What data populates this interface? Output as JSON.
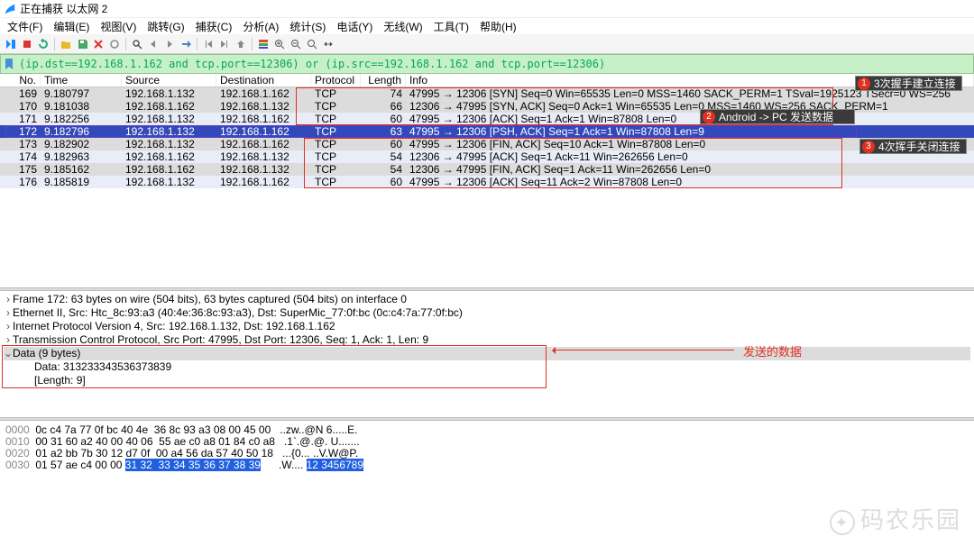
{
  "title": "正在捕获 以太网 2",
  "menu": [
    "文件(F)",
    "编辑(E)",
    "视图(V)",
    "跳转(G)",
    "捕获(C)",
    "分析(A)",
    "统计(S)",
    "电话(Y)",
    "无线(W)",
    "工具(T)",
    "帮助(H)"
  ],
  "filter": "(ip.dst==192.168.1.162 and tcp.port==12306) or (ip.src==192.168.1.162 and tcp.port==12306)",
  "cols": [
    "No.",
    "Time",
    "Source",
    "Destination",
    "Protocol",
    "Length",
    "Info"
  ],
  "rows": [
    {
      "no": "169",
      "time": "9.180797",
      "src": "192.168.1.132",
      "dst": "192.168.1.162",
      "proto": "TCP",
      "len": "74",
      "info": "47995 → 12306 [SYN] Seq=0 Win=65535 Len=0 MSS=1460 SACK_PERM=1 TSval=1925123 TSecr=0 WS=256",
      "cls": "row-grey"
    },
    {
      "no": "170",
      "time": "9.181038",
      "src": "192.168.1.162",
      "dst": "192.168.1.132",
      "proto": "TCP",
      "len": "66",
      "info": "12306 → 47995 [SYN, ACK] Seq=0 Ack=1 Win=65535 Len=0 MSS=1460 WS=256 SACK_PERM=1",
      "cls": "row-grey"
    },
    {
      "no": "171",
      "time": "9.182256",
      "src": "192.168.1.132",
      "dst": "192.168.1.162",
      "proto": "TCP",
      "len": "60",
      "info": "47995 → 12306 [ACK] Seq=1 Ack=1 Win=87808 Len=0",
      "cls": "row-light"
    },
    {
      "no": "172",
      "time": "9.182796",
      "src": "192.168.1.132",
      "dst": "192.168.1.162",
      "proto": "TCP",
      "len": "63",
      "info": "47995 → 12306 [PSH, ACK] Seq=1 Ack=1 Win=87808 Len=9",
      "cls": "row-sel"
    },
    {
      "no": "173",
      "time": "9.182902",
      "src": "192.168.1.132",
      "dst": "192.168.1.162",
      "proto": "TCP",
      "len": "60",
      "info": "47995 → 12306 [FIN, ACK] Seq=10 Ack=1 Win=87808 Len=0",
      "cls": "row-grey"
    },
    {
      "no": "174",
      "time": "9.182963",
      "src": "192.168.1.162",
      "dst": "192.168.1.132",
      "proto": "TCP",
      "len": "54",
      "info": "12306 → 47995 [ACK] Seq=1 Ack=11 Win=262656 Len=0",
      "cls": "row-light"
    },
    {
      "no": "175",
      "time": "9.185162",
      "src": "192.168.1.162",
      "dst": "192.168.1.132",
      "proto": "TCP",
      "len": "54",
      "info": "12306 → 47995 [FIN, ACK] Seq=1 Ack=11 Win=262656 Len=0",
      "cls": "row-grey"
    },
    {
      "no": "176",
      "time": "9.185819",
      "src": "192.168.1.132",
      "dst": "192.168.1.162",
      "proto": "TCP",
      "len": "60",
      "info": "47995 → 12306 [ACK] Seq=11 Ack=2 Win=87808 Len=0",
      "cls": "row-light"
    }
  ],
  "details": {
    "l0": "Frame 172: 63 bytes on wire (504 bits), 63 bytes captured (504 bits) on interface 0",
    "l1": "Ethernet II, Src: Htc_8c:93:a3 (40:4e:36:8c:93:a3), Dst: SuperMic_77:0f:bc (0c:c4:7a:77:0f:bc)",
    "l2": "Internet Protocol Version 4, Src: 192.168.1.132, Dst: 192.168.1.162",
    "l3": "Transmission Control Protocol, Src Port: 47995, Dst Port: 12306, Seq: 1, Ack: 1, Len: 9",
    "l4": "Data (9 bytes)",
    "l5": "Data: 313233343536373839",
    "l6": "[Length: 9]"
  },
  "hex": [
    {
      "off": "0000",
      "b": "0c c4 7a 77 0f bc 40 4e  36 8c 93 a3 08 00 45 00",
      "a": "..zw..@N 6.....E."
    },
    {
      "off": "0010",
      "b": "00 31 60 a2 40 00 40 06  55 ae c0 a8 01 84 c0 a8",
      "a": ".1`.@.@. U......."
    },
    {
      "off": "0020",
      "b": "01 a2 bb 7b 30 12 d7 0f  00 a4 56 da 57 40 50 18",
      "a": "...{0... ..V.W@P."
    },
    {
      "off": "0030",
      "b1": "01 57 ae c4 00 00 ",
      "bhl": "31 32  33 34 35 36 37 38 39",
      "a1": ".W.... ",
      "ahl": "12 3456789"
    }
  ],
  "badges": {
    "b1": "3次握手建立连接",
    "b2": "Android -> PC 发送数据",
    "b3": "4次挥手关闭连接"
  },
  "data_label": "发送的数据",
  "watermark": "码农乐园"
}
